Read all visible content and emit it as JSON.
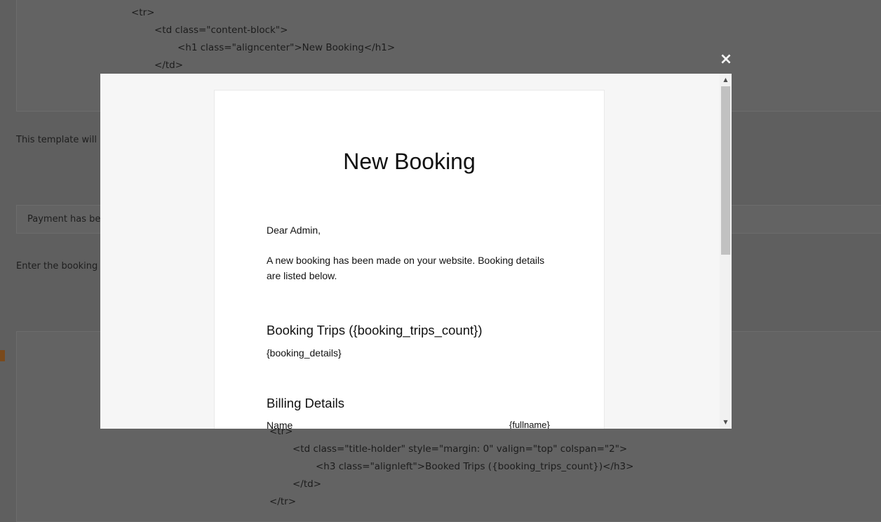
{
  "background": {
    "code_top_lines": [
      "<tr>",
      "<td class=\"content-block\">",
      "<h1 class=\"aligncenter\">New Booking</h1>",
      "</td>"
    ],
    "notice_text": "This template will b",
    "payment_text": "Payment has be",
    "enter_text": "Enter the booking s",
    "code_bottom_lines": [
      "<tr>",
      "<td class=\"title-holder\" style=\"margin: 0\" valign=\"top\" colspan=\"2\">",
      "<h3 class=\"alignleft\">Booked Trips ({booking_trips_count})</h3>",
      "</td>",
      "</tr>"
    ]
  },
  "modal": {
    "close_label": "×",
    "email": {
      "title": "New Booking",
      "greeting": "Dear Admin,",
      "intro": "A new booking has been made on your website. Booking details are listed below.",
      "trips_heading": "Booking Trips ({booking_trips_count})",
      "trips_placeholder": "{booking_details}",
      "billing_heading": "Billing Details",
      "name_label": "Name",
      "name_value": "{fullname}"
    },
    "scroll_up": "▲",
    "scroll_down": "▼"
  }
}
